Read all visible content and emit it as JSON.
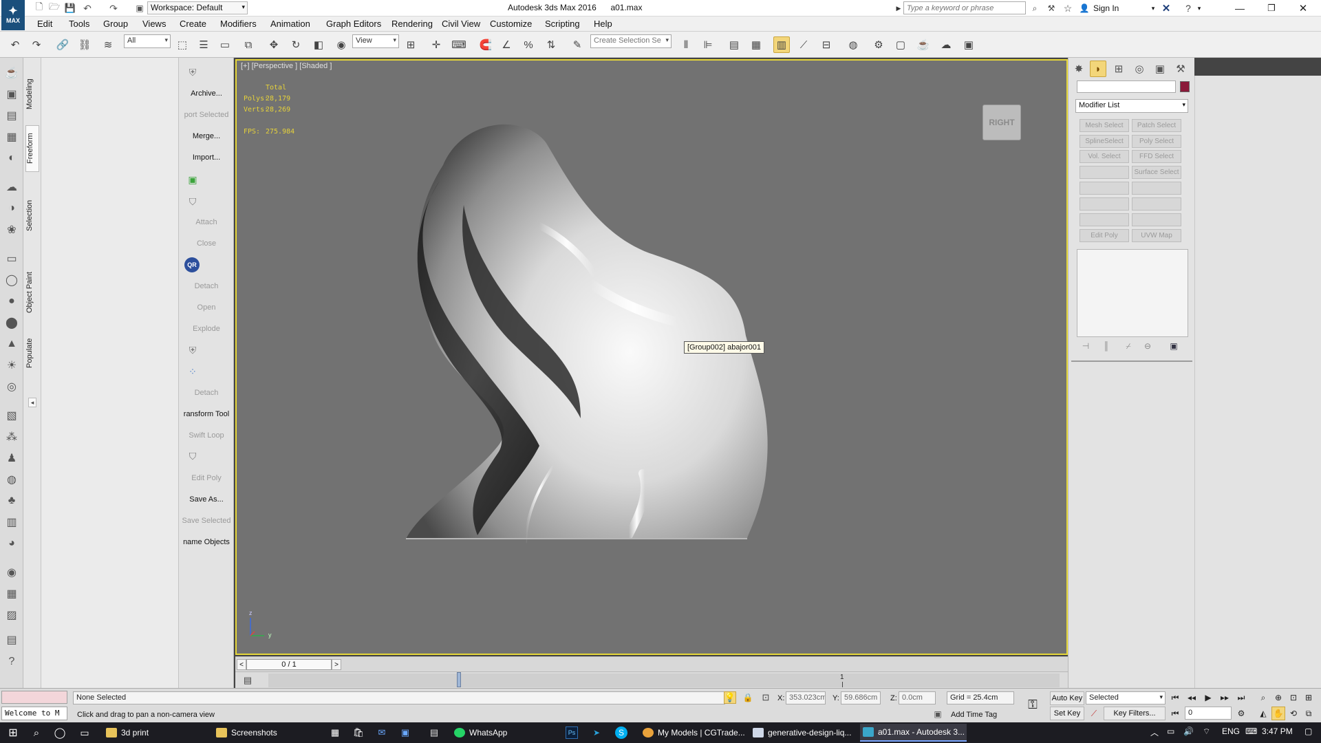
{
  "app": {
    "title": "Autodesk 3ds Max 2016",
    "file": "a01.max",
    "workspace": "Workspace: Default",
    "search_placeholder": "Type a keyword or phrase",
    "signin": "Sign In"
  },
  "menu": [
    "Edit",
    "Tools",
    "Group",
    "Views",
    "Create",
    "Modifiers",
    "Animation",
    "Graph Editors",
    "Rendering",
    "Civil View",
    "Customize",
    "Scripting",
    "Help"
  ],
  "toolbar": {
    "selection_filter": "All",
    "ref_coord": "View",
    "named_selection": "Create Selection Se"
  },
  "ribbon_tabs": [
    "Modeling",
    "Freeform",
    "Selection",
    "Object Paint",
    "Populate"
  ],
  "commands": [
    {
      "label": "Archive...",
      "enabled": true
    },
    {
      "label": "port Selected",
      "enabled": false
    },
    {
      "label": "Merge...",
      "enabled": true
    },
    {
      "label": "Import...",
      "enabled": true
    },
    {
      "label": "Attach",
      "enabled": false
    },
    {
      "label": "Close",
      "enabled": false
    },
    {
      "label": "Detach",
      "enabled": false
    },
    {
      "label": "Open",
      "enabled": false
    },
    {
      "label": "Explode",
      "enabled": false
    },
    {
      "label": "Detach",
      "enabled": false
    },
    {
      "label": "ransform Tool",
      "enabled": true
    },
    {
      "label": "Swift Loop",
      "enabled": false
    },
    {
      "label": "Edit Poly",
      "enabled": false
    },
    {
      "label": "Save As...",
      "enabled": true
    },
    {
      "label": "Save Selected",
      "enabled": false
    },
    {
      "label": "name Objects",
      "enabled": true
    }
  ],
  "viewport": {
    "label": "[+] [Perspective ] [Shaded ]",
    "stats_total": "Total",
    "polys_label": "Polys:",
    "polys_value": "28,179",
    "verts_label": "Verts:",
    "verts_value": "28,269",
    "fps_label": "FPS:",
    "fps_value": "275.984",
    "viewcube": "RIGHT",
    "tooltip": "[Group002] abajor001",
    "axis_z": "z",
    "axis_y": "y"
  },
  "modify_panel": {
    "object_name": "",
    "color": "#8b1a3a",
    "modifier_list": "Modifier List",
    "buttons": [
      "Mesh Select",
      "Patch Select",
      "SplineSelect",
      "Poly Select",
      "Vol. Select",
      "FFD Select",
      "",
      "Surface Select",
      "",
      "",
      "",
      "",
      "",
      "",
      "Edit Poly",
      "UVW Map"
    ]
  },
  "timeline": {
    "frame": "0 / 1",
    "tick": "1"
  },
  "status": {
    "selection": "None Selected",
    "prompt": "Click and drag to pan a non-camera view",
    "maxscript": "Welcome to M",
    "x_label": "X:",
    "x_value": "353.023cm",
    "y_label": "Y:",
    "y_value": "59.686cm",
    "z_label": "Z:",
    "z_value": "0.0cm",
    "grid": "Grid = 25.4cm",
    "add_time_tag": "Add Time Tag",
    "auto_key": "Auto Key",
    "set_key": "Set Key",
    "key_mode": "Selected",
    "key_filters": "Key Filters...",
    "frame_field": "0"
  },
  "taskbar": {
    "items": [
      {
        "label": "3d print",
        "color": "#e8c35a"
      },
      {
        "label": "Screenshots",
        "color": "#e8c35a"
      },
      {
        "label": "WhatsApp",
        "color": "#25d366"
      },
      {
        "label": "My Models | CGTrade...",
        "color": "#e9a23b"
      },
      {
        "label": "generative-design-liq...",
        "color": "#cfd8e8"
      },
      {
        "label": "a01.max - Autodesk 3...",
        "color": "#3aa6c9"
      }
    ],
    "lang": "ENG",
    "time": "3:47 PM"
  }
}
